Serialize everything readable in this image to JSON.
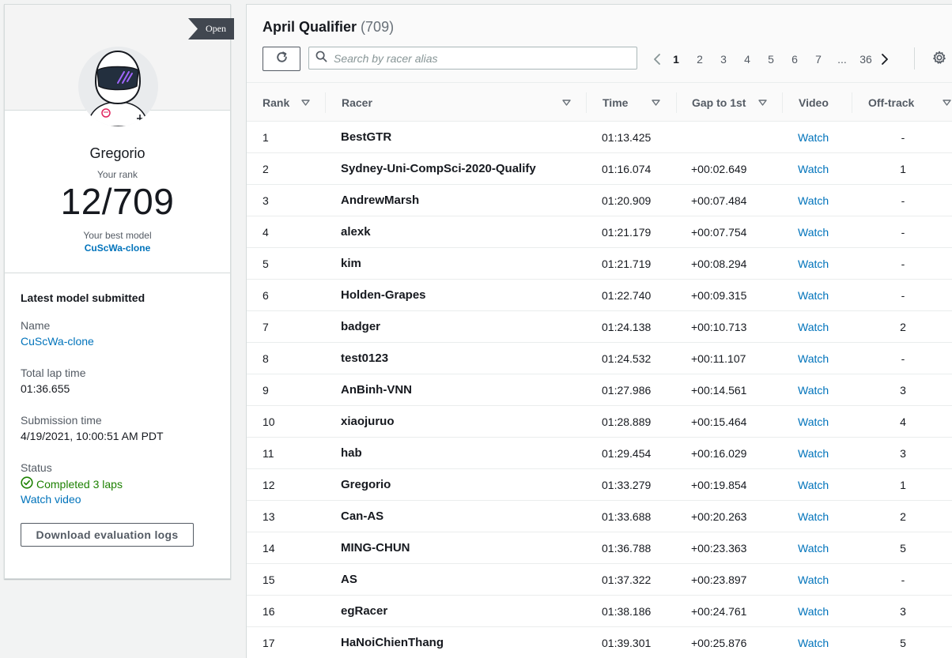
{
  "profile": {
    "badge": "Open",
    "name": "Gregorio",
    "rank_label": "Your rank",
    "rank": "12/709",
    "best_model_label": "Your best model",
    "best_model": "CuScWa-clone"
  },
  "latest": {
    "title": "Latest model submitted",
    "name_label": "Name",
    "name_value": "CuScWa-clone",
    "lap_label": "Total lap time",
    "lap_value": "01:36.655",
    "submission_label": "Submission time",
    "submission_value": "4/19/2021, 10:00:51 AM PDT",
    "status_label": "Status",
    "status_value": "Completed 3 laps",
    "watch_video": "Watch video",
    "download_button": "Download evaluation logs"
  },
  "board": {
    "title": "April Qualifier",
    "count": "(709)",
    "search_placeholder": "Search by racer alias",
    "pages": [
      "1",
      "2",
      "3",
      "4",
      "5",
      "6",
      "7",
      "...",
      "36"
    ],
    "current_page": "1",
    "columns": [
      "Rank",
      "Racer",
      "Time",
      "Gap to 1st",
      "Video",
      "Off-track"
    ],
    "rows": [
      {
        "rank": "1",
        "racer": "BestGTR",
        "time": "01:13.425",
        "gap": "",
        "video": "Watch",
        "off": "-"
      },
      {
        "rank": "2",
        "racer": "Sydney-Uni-CompSci-2020-Qualify",
        "time": "01:16.074",
        "gap": "+00:02.649",
        "video": "Watch",
        "off": "1"
      },
      {
        "rank": "3",
        "racer": "AndrewMarsh",
        "time": "01:20.909",
        "gap": "+00:07.484",
        "video": "Watch",
        "off": "-"
      },
      {
        "rank": "4",
        "racer": "alexk",
        "time": "01:21.179",
        "gap": "+00:07.754",
        "video": "Watch",
        "off": "-"
      },
      {
        "rank": "5",
        "racer": "kim",
        "time": "01:21.719",
        "gap": "+00:08.294",
        "video": "Watch",
        "off": "-"
      },
      {
        "rank": "6",
        "racer": "Holden-Grapes",
        "time": "01:22.740",
        "gap": "+00:09.315",
        "video": "Watch",
        "off": "-"
      },
      {
        "rank": "7",
        "racer": "badger",
        "time": "01:24.138",
        "gap": "+00:10.713",
        "video": "Watch",
        "off": "2"
      },
      {
        "rank": "8",
        "racer": "test0123",
        "time": "01:24.532",
        "gap": "+00:11.107",
        "video": "Watch",
        "off": "-"
      },
      {
        "rank": "9",
        "racer": "AnBinh-VNN",
        "time": "01:27.986",
        "gap": "+00:14.561",
        "video": "Watch",
        "off": "3"
      },
      {
        "rank": "10",
        "racer": "xiaojuruo",
        "time": "01:28.889",
        "gap": "+00:15.464",
        "video": "Watch",
        "off": "4"
      },
      {
        "rank": "11",
        "racer": "hab",
        "time": "01:29.454",
        "gap": "+00:16.029",
        "video": "Watch",
        "off": "3"
      },
      {
        "rank": "12",
        "racer": "Gregorio",
        "time": "01:33.279",
        "gap": "+00:19.854",
        "video": "Watch",
        "off": "1"
      },
      {
        "rank": "13",
        "racer": "Can-AS",
        "time": "01:33.688",
        "gap": "+00:20.263",
        "video": "Watch",
        "off": "2"
      },
      {
        "rank": "14",
        "racer": "MING-CHUN",
        "time": "01:36.788",
        "gap": "+00:23.363",
        "video": "Watch",
        "off": "5"
      },
      {
        "rank": "15",
        "racer": "AS",
        "time": "01:37.322",
        "gap": "+00:23.897",
        "video": "Watch",
        "off": "-"
      },
      {
        "rank": "16",
        "racer": "egRacer",
        "time": "01:38.186",
        "gap": "+00:24.761",
        "video": "Watch",
        "off": "3"
      },
      {
        "rank": "17",
        "racer": "HaNoiChienThang",
        "time": "01:39.301",
        "gap": "+00:25.876",
        "video": "Watch",
        "off": "5"
      }
    ]
  },
  "colors": {
    "link": "#0073bb",
    "success": "#1d8102",
    "text": "#16191f",
    "muted": "#545b64",
    "badge": "#414750"
  },
  "icons": {
    "refresh": "refresh-icon",
    "search": "search-icon",
    "prev": "chevron-left-icon",
    "next": "chevron-right-icon",
    "settings": "gear-icon",
    "sort": "caret-down-icon",
    "status": "check-circle-icon",
    "avatar": "racer-helmet-avatar"
  }
}
